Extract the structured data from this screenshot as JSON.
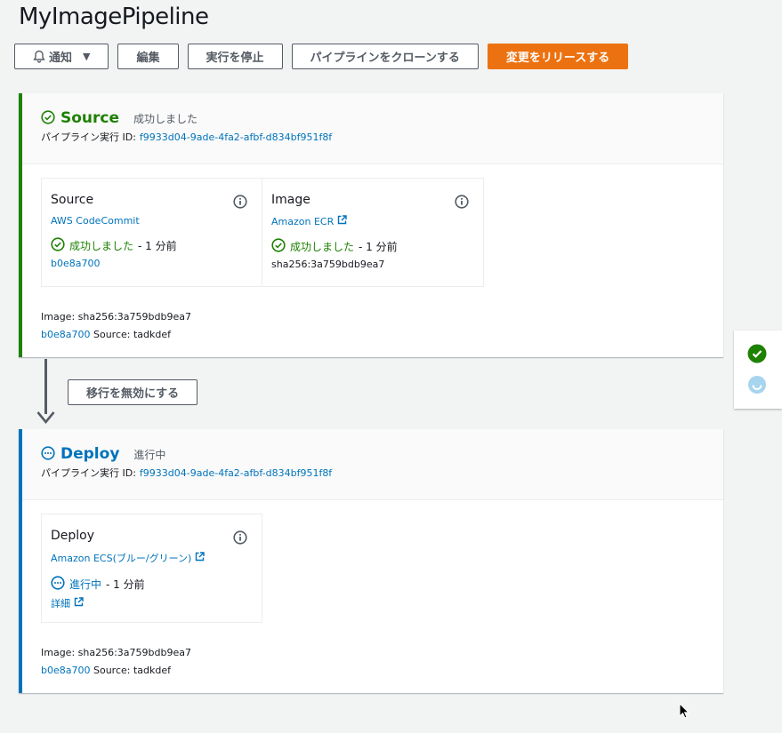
{
  "page": {
    "title": "MyImagePipeline"
  },
  "toolbar": {
    "notify_label": "通知",
    "edit_label": "編集",
    "stop_label": "実行を停止",
    "clone_label": "パイプラインをクローンする",
    "release_label": "変更をリリースする"
  },
  "exec_id_label": "パイプライン実行 ID:",
  "stages": {
    "source": {
      "name": "Source",
      "status": "成功しました",
      "exec_id": "f9933d04-9ade-4fa2-afbf-d834bf951f8f",
      "actions": [
        {
          "title": "Source",
          "provider": "AWS CodeCommit",
          "status": "成功しました",
          "time": "- 1 分前",
          "detail": "b0e8a700"
        },
        {
          "title": "Image",
          "provider": "Amazon ECR",
          "status": "成功しました",
          "time": "- 1 分前",
          "detail": "sha256:3a759bdb9ea7"
        }
      ],
      "artifact_image": "Image: sha256:3a759bdb9ea7",
      "artifact_commit": "b0e8a700",
      "artifact_source": "Source: tadkdef"
    },
    "deploy": {
      "name": "Deploy",
      "status": "進行中",
      "exec_id": "f9933d04-9ade-4fa2-afbf-d834bf951f8f",
      "actions": [
        {
          "title": "Deploy",
          "provider": "Amazon ECS(ブルー/グリーン)",
          "status": "進行中",
          "time": "- 1 分前",
          "detail": "詳細"
        }
      ],
      "artifact_image": "Image: sha256:3a759bdb9ea7",
      "artifact_commit": "b0e8a700",
      "artifact_source": "Source: tadkdef"
    }
  },
  "transition": {
    "disable_label": "移行を無効にする"
  },
  "colors": {
    "success": "#1d8102",
    "progress": "#0073bb",
    "primary": "#ec7211"
  },
  "icons": [
    "bell-icon",
    "caret-down-icon",
    "check-circle-icon",
    "info-icon",
    "external-link-icon",
    "in-progress-icon",
    "arrow-down-icon",
    "cursor-icon"
  ]
}
